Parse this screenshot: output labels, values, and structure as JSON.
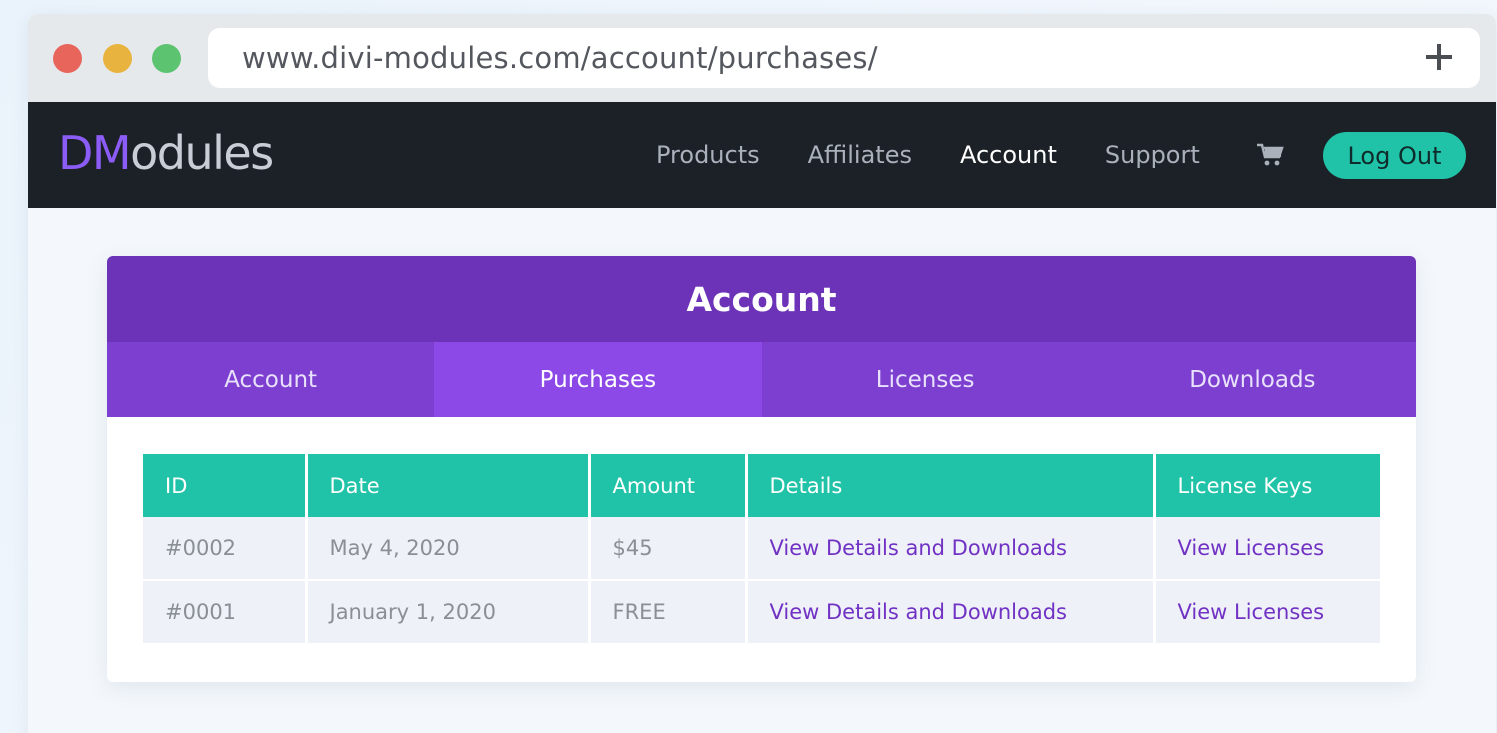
{
  "browser": {
    "url": "www.divi-modules.com/account/purchases/"
  },
  "nav": {
    "logo_accent": "DM",
    "logo_rest": "odules",
    "links": [
      "Products",
      "Affiliates",
      "Account",
      "Support"
    ],
    "active": "Account",
    "logout_label": "Log Out"
  },
  "card": {
    "title": "Account",
    "tabs": [
      "Account",
      "Purchases",
      "Licenses",
      "Downloads"
    ],
    "active_tab": "Purchases"
  },
  "table": {
    "headers": [
      "ID",
      "Date",
      "Amount",
      "Details",
      "License Keys"
    ],
    "rows": [
      {
        "id": "#0002",
        "date": "May 4, 2020",
        "amount": "$45",
        "details": "View Details and Downloads",
        "license": "View Licenses"
      },
      {
        "id": "#0001",
        "date": "January 1, 2020",
        "amount": "FREE",
        "details": "View Details and Downloads",
        "license": "View Licenses"
      }
    ]
  },
  "colors": {
    "nav_bg": "#1c2127",
    "header_purple": "#6c33b8",
    "tab_purple": "#7c3fd0",
    "tab_active": "#8c49e8",
    "teal": "#20c3a8",
    "link_purple": "#7132c4"
  }
}
